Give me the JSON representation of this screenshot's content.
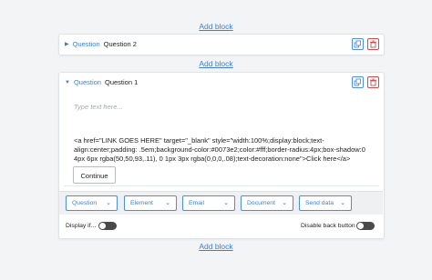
{
  "add_block_label": "Add block",
  "colors": {
    "accent": "#3d7fd6",
    "danger": "#d24b4b",
    "toggle": "#4a4a4a"
  },
  "collapsed_question": {
    "type_label": "Question",
    "name": "Question 2",
    "caret_icon": "caret-right-icon"
  },
  "expanded_question": {
    "type_label": "Question",
    "name": "Question 1",
    "caret_icon": "caret-down-icon",
    "placeholder": "Type text here...",
    "html_content": "<a href=\"LINK GOES HERE\" target=\"_blank\" style=\"width:100%;display:block;text-align:center;padding: .5em;background-color:#0073e2;color:#fff;border-radius:4px;box-shadow:0 4px 6px rgba(50,50,93,.11), 0 1px 3px rgba(0,0,0,.08);text-decoration:none\">Click here</a>",
    "continue_label": "Continue"
  },
  "toolbar": {
    "dropdowns": [
      "Question",
      "Element",
      "Email",
      "Document",
      "Send data"
    ]
  },
  "options": {
    "display_if_label": "Display if...",
    "disable_back_label": "Disable back button"
  }
}
